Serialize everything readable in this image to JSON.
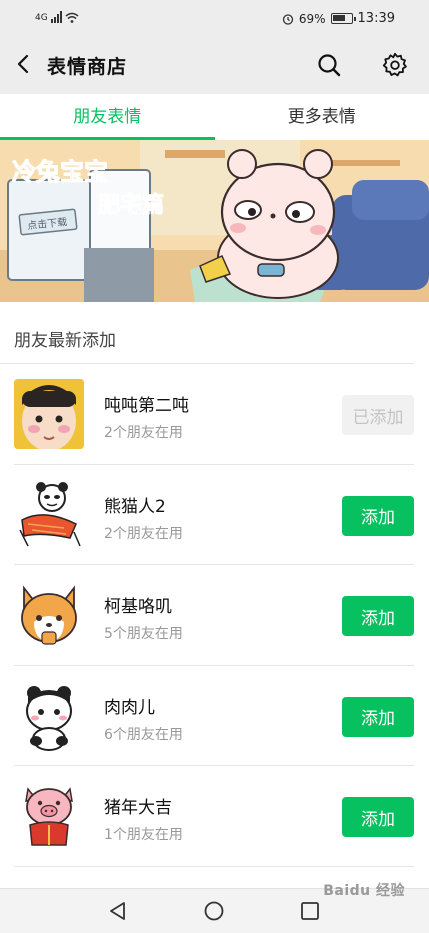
{
  "status": {
    "carrier": "4G",
    "battery": "69%",
    "battery_level": 0.69,
    "time": "13:39"
  },
  "header": {
    "title": "表情商店"
  },
  "tabs": [
    {
      "label": "朋友表情",
      "active": true
    },
    {
      "label": "更多表情",
      "active": false
    }
  ],
  "banner": {
    "title": "冷兔宝宝",
    "subtitle": "肥宅篇",
    "sign": "点击下载"
  },
  "section": {
    "title": "朋友最新添加"
  },
  "items": [
    {
      "name": "吨吨第二吨",
      "sub": "2个朋友在用",
      "button": "已添加",
      "added": true
    },
    {
      "name": "熊猫人2",
      "sub": "2个朋友在用",
      "button": "添加",
      "added": false
    },
    {
      "name": "柯基咯叽",
      "sub": "5个朋友在用",
      "button": "添加",
      "added": false
    },
    {
      "name": "肉肉儿",
      "sub": "6个朋友在用",
      "button": "添加",
      "added": false
    },
    {
      "name": "猪年大吉",
      "sub": "1个朋友在用",
      "button": "添加",
      "added": false
    }
  ],
  "watermark": "Baidu 经验",
  "colors": {
    "accent": "#07c160",
    "background": "#ededed",
    "disabled": "#f1f1f1"
  }
}
